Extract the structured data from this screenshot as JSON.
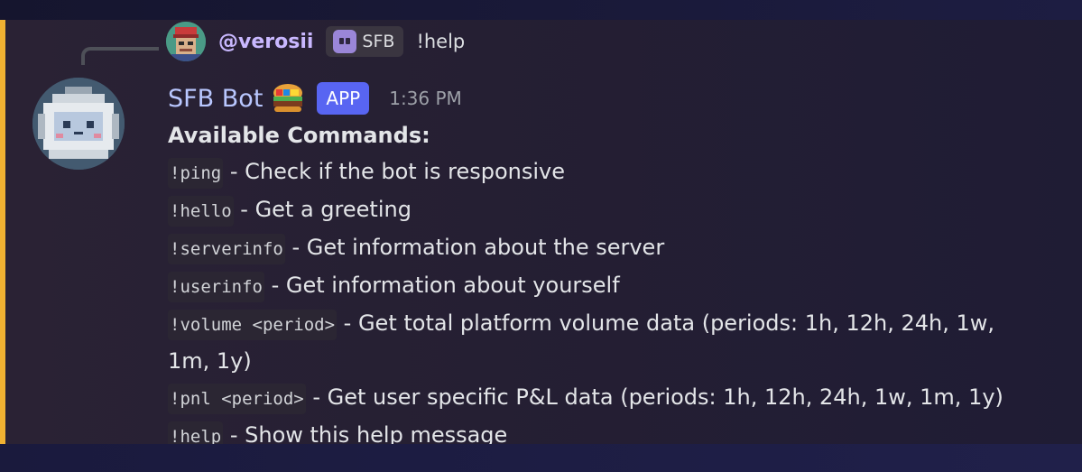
{
  "reply": {
    "author": "@verosii",
    "tag": "SFB",
    "content": "!help"
  },
  "message": {
    "author": "SFB Bot",
    "badge": "APP",
    "timestamp": "1:36 PM",
    "heading": "Available Commands:",
    "commands": [
      {
        "cmd": "!ping",
        "desc": "- Check if the bot is responsive"
      },
      {
        "cmd": "!hello",
        "desc": "- Get a greeting"
      },
      {
        "cmd": "!serverinfo",
        "desc": "- Get information about the server"
      },
      {
        "cmd": "!userinfo",
        "desc": "- Get information about yourself"
      },
      {
        "cmd": "!volume <period>",
        "desc": "- Get total platform volume data (periods: 1h, 12h, 24h, 1w, 1m, 1y)"
      },
      {
        "cmd": "!pnl <period>",
        "desc": "- Get user specific P&L data (periods: 1h, 12h, 24h, 1w, 1m, 1y)"
      },
      {
        "cmd": "!help",
        "desc": "- Show this help message"
      }
    ]
  },
  "colors": {
    "accent_bar": "#f0b132",
    "app_badge": "#5865f2",
    "bot_name": "#b9c7ff",
    "reply_author": "#c9b8ff"
  },
  "icons": {
    "reply_avatar": "pixel-art-avatar-icon",
    "tag": "ghost-icon",
    "bot_avatar": "robot-avatar-icon",
    "bot_emoji": "sfb-burger-icon"
  }
}
